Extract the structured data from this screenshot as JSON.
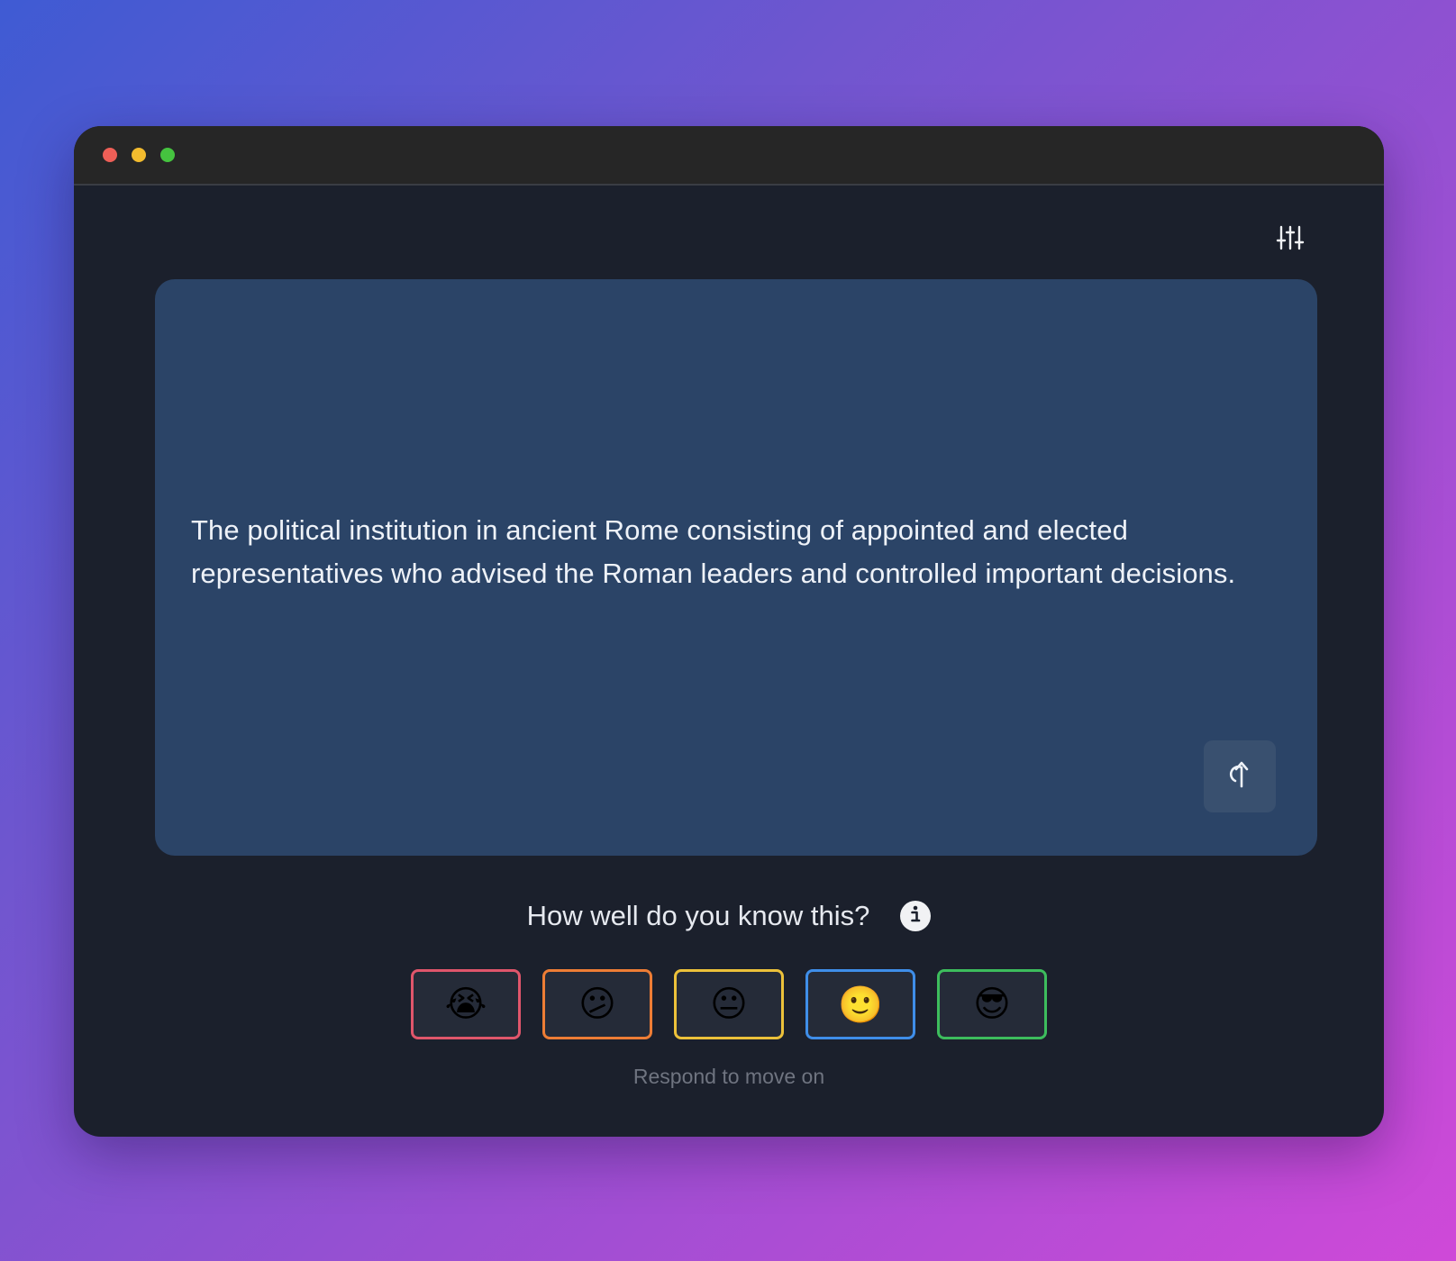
{
  "window": {
    "controls": [
      "close",
      "minimize",
      "maximize"
    ]
  },
  "toolbar": {
    "settings_icon": "sliders-icon"
  },
  "card": {
    "text": "The political institution in ancient Rome consisting of appointed and elected representatives who advised the Roman leaders and controlled important decisions.",
    "flip_icon": "flip-arrow-icon"
  },
  "prompt": {
    "question": "How well do you know this?",
    "info_icon": "info-icon"
  },
  "ratings": [
    {
      "emoji": "😭",
      "name": "rating-1-button",
      "color": "#e0566b"
    },
    {
      "emoji": "😕",
      "name": "rating-2-button",
      "color": "#ee7d35"
    },
    {
      "emoji": "😐",
      "name": "rating-3-button",
      "color": "#ecc13a"
    },
    {
      "emoji": "🙂",
      "name": "rating-4-button",
      "color": "#3f8ee9"
    },
    {
      "emoji": "😎",
      "name": "rating-5-button",
      "color": "#3dbd5d"
    }
  ],
  "hint": "Respond to move on",
  "colors": {
    "card": "#2b4467",
    "window_bg": "#1b202c",
    "titlebar": "#262626"
  }
}
